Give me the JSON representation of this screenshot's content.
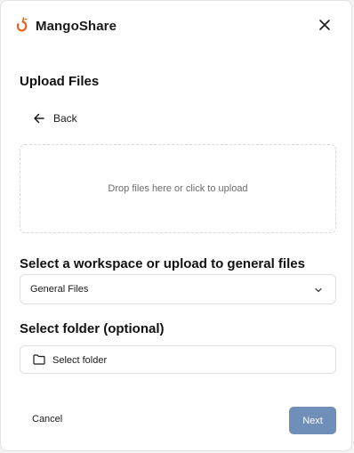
{
  "app": {
    "title": "MangoShare",
    "logo_icon": "mango-logo-icon",
    "brand_color": "#e8641e"
  },
  "dialog": {
    "heading": "Upload Files",
    "back_label": "Back",
    "dropzone_text": "Drop files here or click to upload",
    "workspace": {
      "label": "Select a workspace or upload to general files",
      "selected": "General Files"
    },
    "folder": {
      "label": "Select folder (optional)",
      "button_label": "Select folder"
    },
    "footer": {
      "cancel_label": "Cancel",
      "next_label": "Next",
      "next_color": "#6f8fb8"
    }
  }
}
